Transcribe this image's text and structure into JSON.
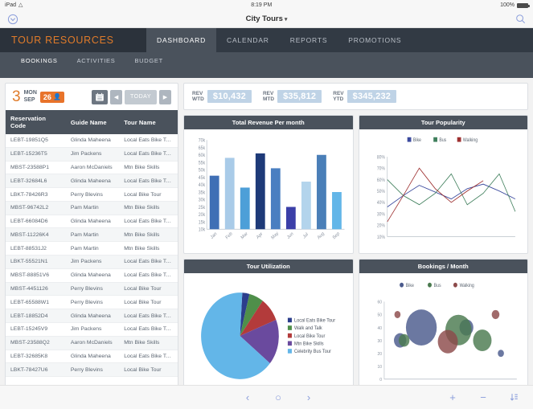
{
  "status_bar": {
    "device": "iPad",
    "wifi_icon": "wifi-icon",
    "time": "8:19 PM",
    "battery_percent": "100%"
  },
  "title_bar": {
    "back_icon": "chevron-circle-down-icon",
    "title": "City Tours",
    "caret": "▾",
    "search_icon": "search-icon"
  },
  "nav": {
    "brand": "TOUR RESOURCES",
    "tabs": [
      {
        "label": "DASHBOARD",
        "active": true
      },
      {
        "label": "CALENDAR",
        "active": false
      },
      {
        "label": "REPORTS",
        "active": false
      },
      {
        "label": "PROMOTIONS",
        "active": false
      }
    ],
    "subtabs": [
      {
        "label": "BOOKINGS",
        "active": true
      },
      {
        "label": "ACTIVITIES",
        "active": false
      },
      {
        "label": "BUDGET",
        "active": false
      }
    ]
  },
  "date_header": {
    "day_number": "3",
    "weekday": "MON",
    "month": "SEP",
    "badge_count": "26",
    "person_icon": "person-icon",
    "calendar_icon": "calendar-icon",
    "prev_icon": "◀",
    "today_label": "TODAY",
    "next_icon": "▶"
  },
  "table": {
    "columns": [
      "Reservation Code",
      "Guide Name",
      "Tour Name"
    ],
    "rows": [
      [
        "LEBT-19851Q5",
        "Glinda Maheena",
        "Local Eats Bike Tour"
      ],
      [
        "LEBT-15236T5",
        "Jim Packens",
        "Local Eats Bike Tour"
      ],
      [
        "MBST-23588P1",
        "Aaron McDaniels",
        "Mtn Bike Skills"
      ],
      [
        "LEBT-32684L6",
        "Glinda Maheena",
        "Local Eats Bike Tour"
      ],
      [
        "LBKT-78426R3",
        "Perry Blevins",
        "Local Bike Tour"
      ],
      [
        "MBST-96742L2",
        "Pam Martin",
        "Mtn Bike Skills"
      ],
      [
        "LEBT-66084D6",
        "Glinda Maheena",
        "Local Eats Bike Tour"
      ],
      [
        "MBST-11226K4",
        "Pam Martin",
        "Mtn Bike Skills"
      ],
      [
        "LEBT-88531J2",
        "Pam Martin",
        "Mtn Bike Skills"
      ],
      [
        "LBKT-55521N1",
        "Jim Packens",
        "Local Eats Bike Tour"
      ],
      [
        "MBST-88851V6",
        "Glinda Maheena",
        "Local Eats Bike Tour"
      ],
      [
        "MBST-4451126",
        "Perry Blevins",
        "Local Bike Tour"
      ],
      [
        "LEBT-65588W1",
        "Perry Blevins",
        "Local Bike Tour"
      ],
      [
        "LEBT-18852D4",
        "Glinda Maheena",
        "Local Eats Bike Tour"
      ],
      [
        "LEBT-15245V9",
        "Jim Packens",
        "Local Eats Bike Tour"
      ],
      [
        "MBST-23588Q2",
        "Aaron McDaniels",
        "Mtn Bike Skills"
      ],
      [
        "LEBT-32685K8",
        "Glinda Maheena",
        "Local Eats Bike Tour"
      ],
      [
        "LBKT-78427U6",
        "Perry Blevins",
        "Local Bike Tour"
      ]
    ]
  },
  "kpis": [
    {
      "label_line1": "REV",
      "label_line2": "WTD",
      "value": "$10,432"
    },
    {
      "label_line1": "REV",
      "label_line2": "MTD",
      "value": "$35,812"
    },
    {
      "label_line1": "REV",
      "label_line2": "YTD",
      "value": "$345,232"
    }
  ],
  "cards": {
    "revenue_title": "Total Revenue Per month",
    "popularity_title": "Tour Popularity",
    "utilization_title": "Tour Utilization",
    "bookings_title": "Bookings / Month"
  },
  "bottom_bar": {
    "back_icon": "‹",
    "stop_icon": "○",
    "forward_icon": "›",
    "add_icon": "+",
    "remove_icon": "−",
    "sort_icon": "sort-icon"
  },
  "chart_data": [
    {
      "id": "revenue",
      "type": "bar",
      "title": "Total Revenue Per month",
      "xlabel": "",
      "ylabel": "",
      "categories": [
        "Jan",
        "Feb",
        "Mar",
        "Apr",
        "May",
        "Jun",
        "Jul",
        "Aug",
        "Sep"
      ],
      "values": [
        46,
        58,
        38,
        61,
        51,
        25,
        42,
        60,
        35
      ],
      "ytick_labels": [
        "70k",
        "65k",
        "60k",
        "55k",
        "50k",
        "45k",
        "40k",
        "35k",
        "30k",
        "25k",
        "20k",
        "15k",
        "10k"
      ],
      "ylim": [
        10,
        70
      ],
      "bar_colors": [
        "#3f6fb5",
        "#a9cbe8",
        "#4d9fd8",
        "#1e3a78",
        "#4a7fc1",
        "#3b3fa8",
        "#b3d4ec",
        "#4a7fb8",
        "#63b6e8"
      ],
      "grid": false,
      "legend": "none"
    },
    {
      "id": "popularity",
      "type": "line",
      "title": "Tour Popularity",
      "xlabel": "",
      "ylabel": "",
      "ytick_labels": [
        "80%",
        "70%",
        "60%",
        "50%",
        "40%",
        "30%",
        "20%",
        "10%"
      ],
      "ylim": [
        10,
        80
      ],
      "x": [
        1,
        2,
        3,
        4,
        5,
        6,
        7,
        8,
        9
      ],
      "series": [
        {
          "name": "Bike",
          "color": "#3b4a9e",
          "values": [
            36,
            46,
            55,
            49,
            43,
            52,
            56,
            50,
            43
          ]
        },
        {
          "name": "Bus",
          "color": "#3f7f5c",
          "values": [
            60,
            46,
            38,
            48,
            65,
            38,
            48,
            65,
            32
          ]
        },
        {
          "name": "Walking",
          "color": "#9e3030",
          "values": [
            23,
            46,
            70,
            52,
            40,
            50,
            59,
            null,
            null
          ]
        }
      ],
      "legend": "top"
    },
    {
      "id": "utilization",
      "type": "pie",
      "title": "Tour Utilization",
      "labels": [
        "Local Eats Bike Tour",
        "Walk and Talk",
        "Local Bike Tour",
        "Mtn Bike Skills",
        "Celebrity Bus Tour"
      ],
      "values": [
        3,
        6,
        9,
        17,
        65
      ],
      "colors": [
        "#2b3e8c",
        "#4f8f4a",
        "#b33b3b",
        "#6a4a9e",
        "#63b6e8"
      ],
      "legend": "right"
    },
    {
      "id": "bookings",
      "type": "scatter",
      "title": "Bookings / Month",
      "xlabel": "",
      "ylabel": "",
      "ytick_labels": [
        "60",
        "50",
        "40",
        "30",
        "20",
        "10",
        "0"
      ],
      "ylim": [
        0,
        60
      ],
      "series": [
        {
          "name": "Bike",
          "color": "#4a5a8c",
          "points": [
            {
              "x": 12,
              "y": 30,
              "r": 8
            },
            {
              "x": 28,
              "y": 40,
              "r": 20
            },
            {
              "x": 62,
              "y": 40,
              "r": 9
            },
            {
              "x": 88,
              "y": 20,
              "r": 4
            }
          ]
        },
        {
          "name": "Bus",
          "color": "#4a7a4f",
          "points": [
            {
              "x": 15,
              "y": 30,
              "r": 7
            },
            {
              "x": 56,
              "y": 38,
              "r": 17
            },
            {
              "x": 74,
              "y": 30,
              "r": 12
            }
          ]
        },
        {
          "name": "Walking",
          "color": "#8c4a4a",
          "points": [
            {
              "x": 10,
              "y": 50,
              "r": 4
            },
            {
              "x": 48,
              "y": 29,
              "r": 13
            },
            {
              "x": 84,
              "y": 50,
              "r": 5
            }
          ]
        }
      ],
      "legend": "top"
    }
  ]
}
